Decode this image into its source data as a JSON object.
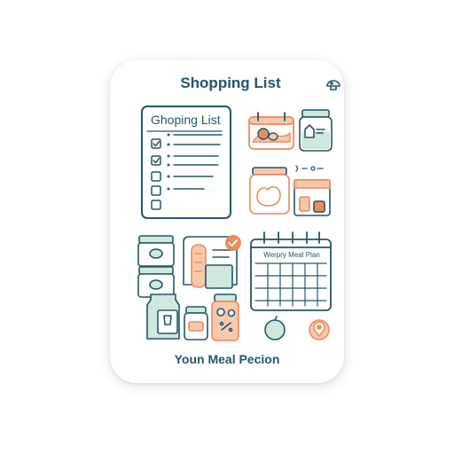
{
  "header": {
    "title": "Shopping List",
    "action_icon": "mushroom-icon"
  },
  "shopping_list": {
    "title": "Ghoping List",
    "items": [
      {
        "checked": true
      },
      {
        "checked": true
      },
      {
        "checked": false
      },
      {
        "checked": false
      },
      {
        "checked": false
      }
    ]
  },
  "calendar": {
    "title": "Werpry Meal Plan"
  },
  "footer": {
    "caption": "Youn Meal Pecion"
  },
  "colors": {
    "navy": "#24566a",
    "orange": "#ee8a5c",
    "mint": "#cfe8dc",
    "peach": "#f6c9ad",
    "card": "#ffffff"
  }
}
